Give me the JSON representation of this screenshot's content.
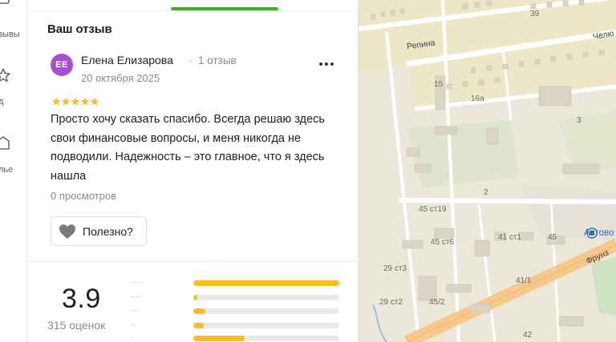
{
  "rail": {
    "items": [
      {
        "label": "зывы",
        "icon": "reviews-icon"
      },
      {
        "label": "д",
        "icon": "star-icon"
      },
      {
        "label": "лье",
        "icon": "building-icon"
      }
    ]
  },
  "review_section": {
    "title": "Ваш отзыв"
  },
  "review": {
    "avatar_initials": "ЕЕ",
    "avatar_color": "#a74fd1",
    "author": "Елена Елизарова",
    "separator": "·",
    "author_reviews": "1 отзыв",
    "date": "20 октября 2025",
    "stars": 5,
    "text": "Просто хочу сказать спасибо. Всегда решаю здесь свои финансовые вопросы, и меня никогда не подводили. Надежность – это главное, что я здесь нашла",
    "views": "0 просмотров",
    "useful_label": "Полезно?"
  },
  "rating": {
    "value": "3.9",
    "count": "315 оценок",
    "distribution": [
      {
        "stars": 5,
        "fraction": 1.0
      },
      {
        "stars": 4,
        "fraction": 0.03
      },
      {
        "stars": 3,
        "fraction": 0.08
      },
      {
        "stars": 2,
        "fraction": 0.07
      },
      {
        "stars": 1,
        "fraction": 0.35
      }
    ]
  },
  "colors": {
    "accent_green": "#3fae29",
    "star_yellow": "#fbbc24",
    "star_grey": "#cfcfcf"
  },
  "map": {
    "labels": [
      "39",
      "Репина",
      "Челю",
      "15",
      "16а",
      "3",
      "2",
      "45 ст19",
      "45 ст6",
      "41 ст1",
      "45",
      "Автово",
      "29 ст3",
      "Фрунз",
      "41/1",
      "29 ст2",
      "45/2",
      "42"
    ]
  }
}
